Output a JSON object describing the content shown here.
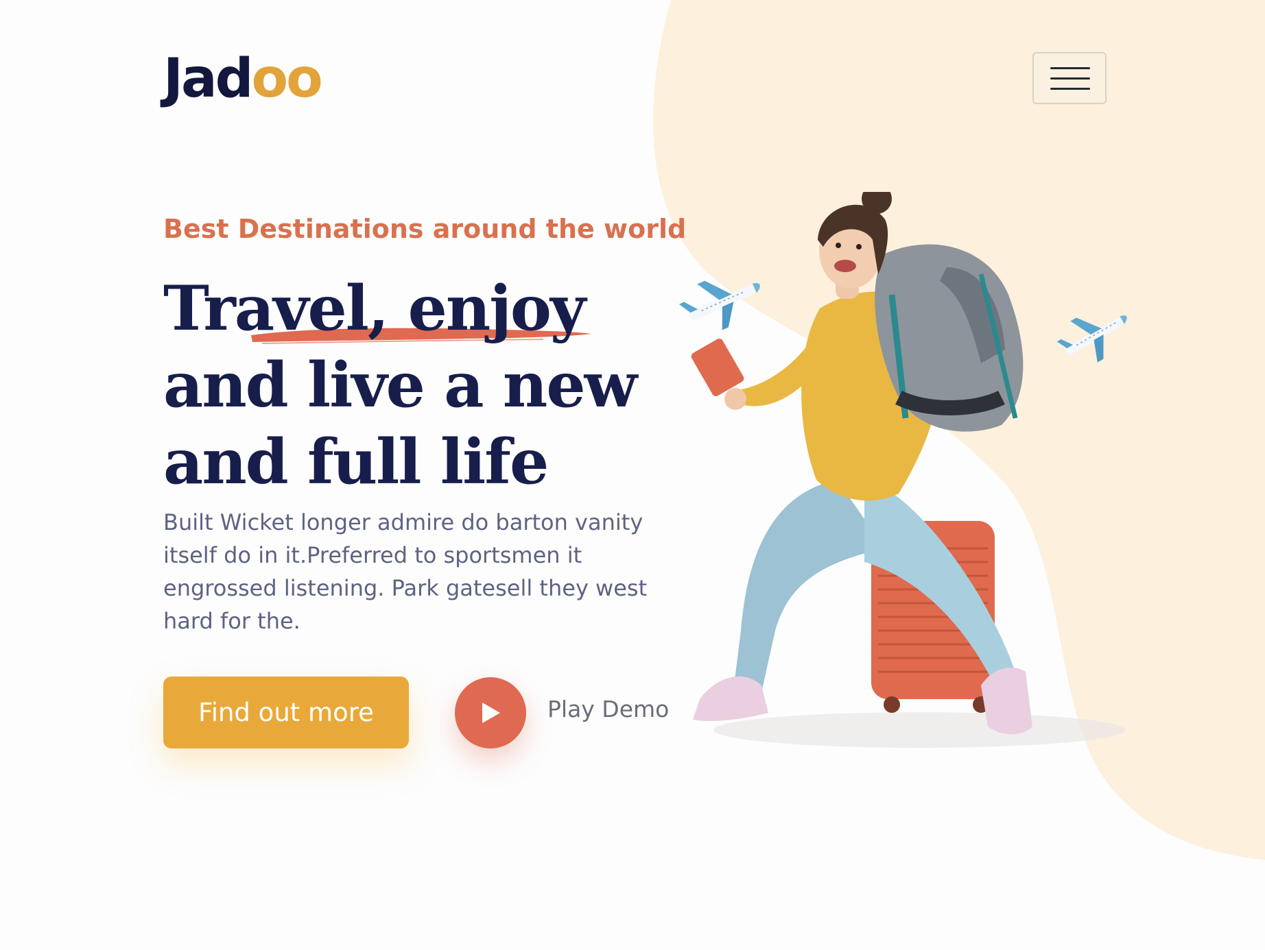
{
  "header": {
    "logo_main": "Jad",
    "logo_accent": "oo",
    "menu_button_icon": "hamburger-icon"
  },
  "hero": {
    "eyebrow": "Best Destinations around the world",
    "headline_lines": [
      "Travel, enjoy",
      "and live a new",
      "and full life"
    ],
    "description": "Built Wicket longer admire do barton vanity itself do in it.Preferred to sportsmen it engrossed listening. Park gatesell they west hard for the.",
    "cta_label": "Find out more",
    "play_label": "Play Demo",
    "play_icon": "play-icon",
    "illustration": "traveler-with-backpack-on-suitcase",
    "plane_icon": "airplane-icon"
  },
  "colors": {
    "brand_dark": "#181e4b",
    "accent_orange": "#df6951",
    "accent_yellow": "#e8a93a",
    "blob": "#fdf0dc",
    "body_text": "#5e6282"
  }
}
